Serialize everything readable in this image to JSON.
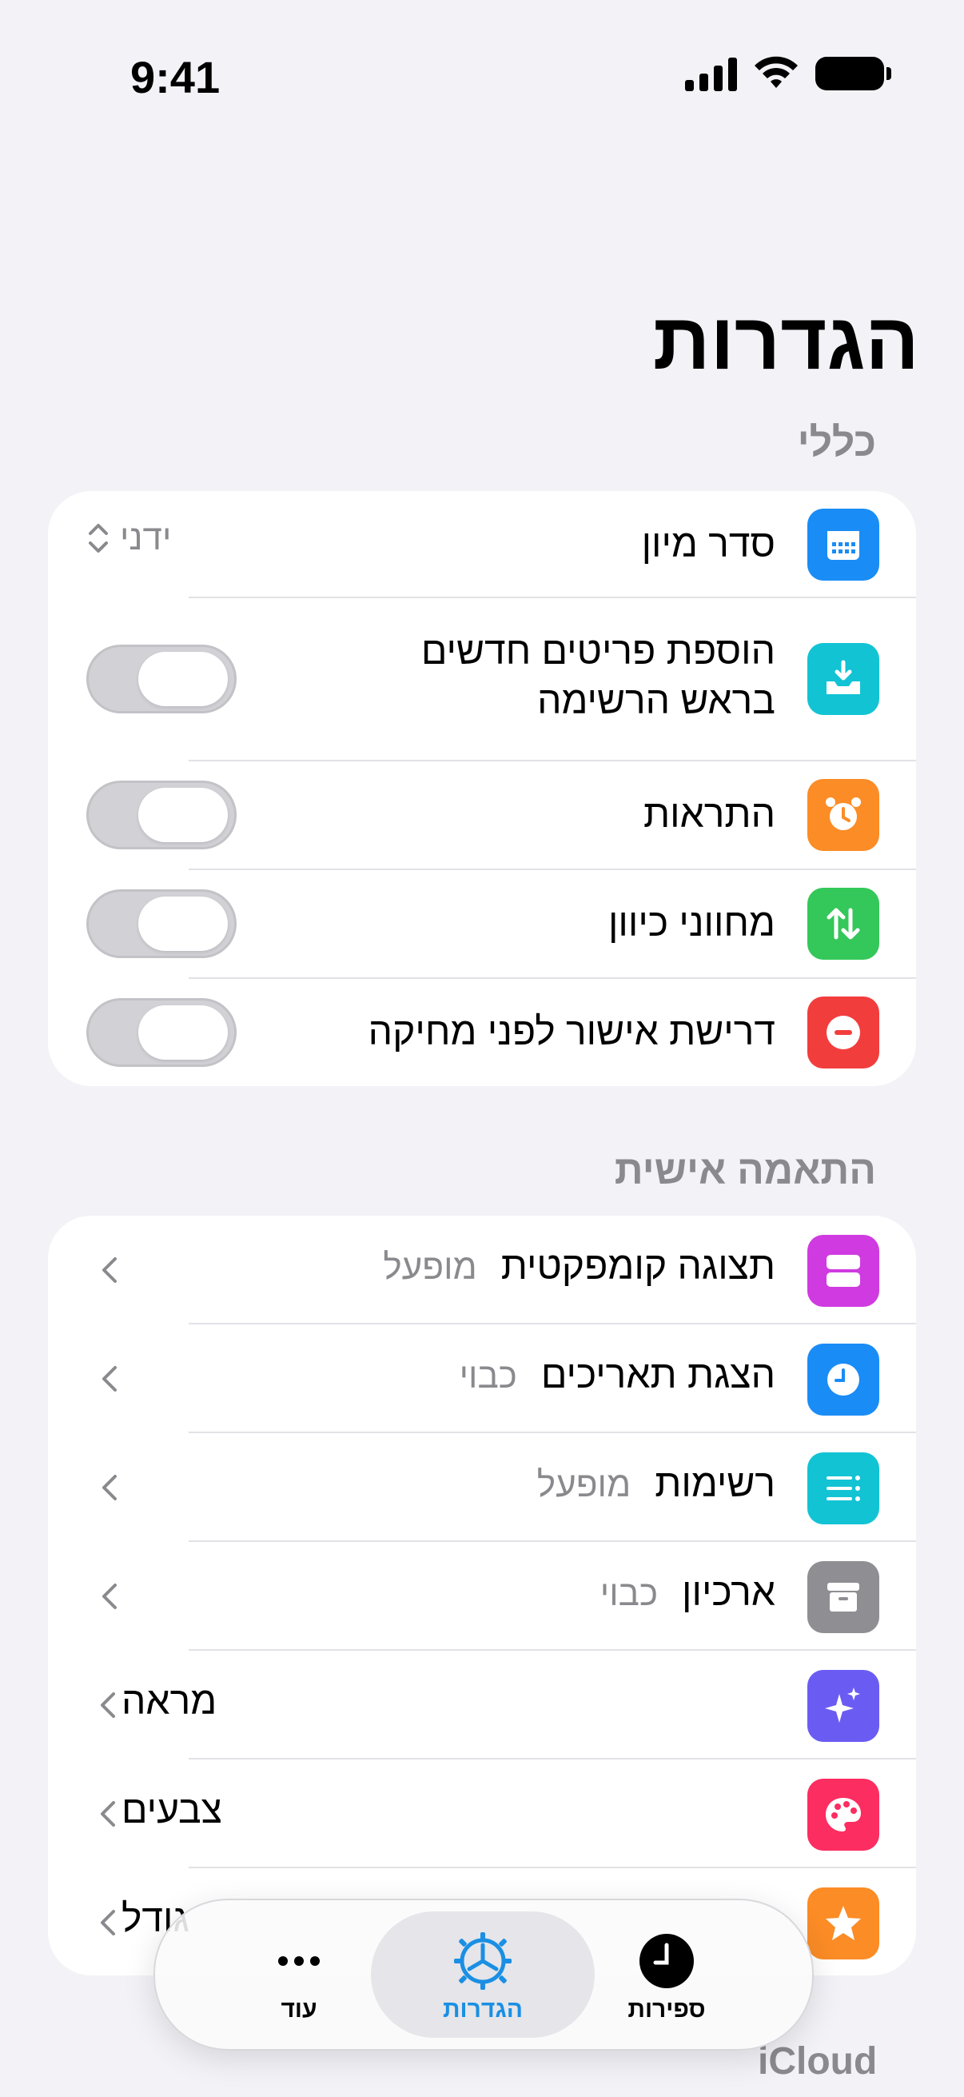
{
  "status": {
    "time": "9:41"
  },
  "page": {
    "title": "הגדרות"
  },
  "sections": {
    "general": {
      "header": "כללי",
      "sort_order": {
        "label": "סדר מיון",
        "value": "ידני"
      },
      "add_new_top": {
        "label_line1": "הוספת פריטים חדשים",
        "label_line2": "בראש הרשימה",
        "enabled": false
      },
      "notifications": {
        "label": "התראות",
        "enabled": false
      },
      "direction_indicators": {
        "label": "מחווני כיוון",
        "enabled": false
      },
      "confirm_delete": {
        "label": "דרישת אישור לפני מחיקה",
        "enabled": false
      }
    },
    "personalization": {
      "header": "התאמה אישית",
      "compact_view": {
        "label": "תצוגה קומפקטית",
        "value": "מופעל"
      },
      "show_dates": {
        "label": "הצגת תאריכים",
        "value": "כבוי"
      },
      "lists": {
        "label": "רשימות",
        "value": "מופעל"
      },
      "archive": {
        "label": "ארכיון",
        "value": "כבוי"
      },
      "appearance": {
        "label": "מראה"
      },
      "colors": {
        "label": "צבעים"
      },
      "size": {
        "label": "גודל"
      }
    },
    "icloud": {
      "header": "iCloud"
    }
  },
  "tabbar": {
    "more": "עוד",
    "settings": "הגדרות",
    "counters": "ספירות"
  },
  "colors": {
    "accent": "#1a8fe3",
    "blue": "#1a8cf5",
    "teal": "#12c3d4",
    "orange": "#fb8c26",
    "green": "#34c759",
    "red": "#f23d3d",
    "purple": "#cf3be0",
    "gray": "#8e8e93",
    "indigo": "#6a5cf3",
    "pink": "#fc2d61"
  }
}
